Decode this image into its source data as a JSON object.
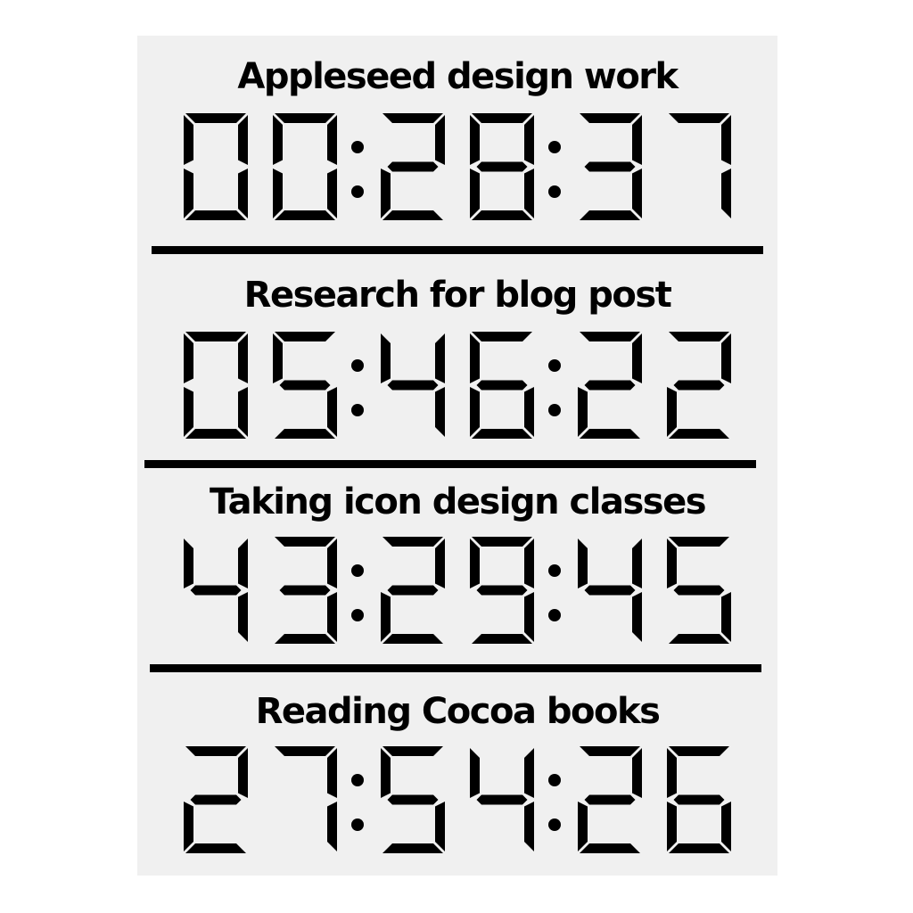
{
  "timers": [
    {
      "name": "Appleseed design work",
      "time": "00:28:37"
    },
    {
      "name": "Research for blog post",
      "time": "05:46:22"
    },
    {
      "name": "Taking icon design classes",
      "time": "43:29:45"
    },
    {
      "name": "Reading Cocoa books",
      "time": "27:54:26"
    }
  ],
  "colors": {
    "background": "#ffffff",
    "panel": "#f0f0f0",
    "ink": "#000000"
  },
  "display_style": "seven-segment"
}
